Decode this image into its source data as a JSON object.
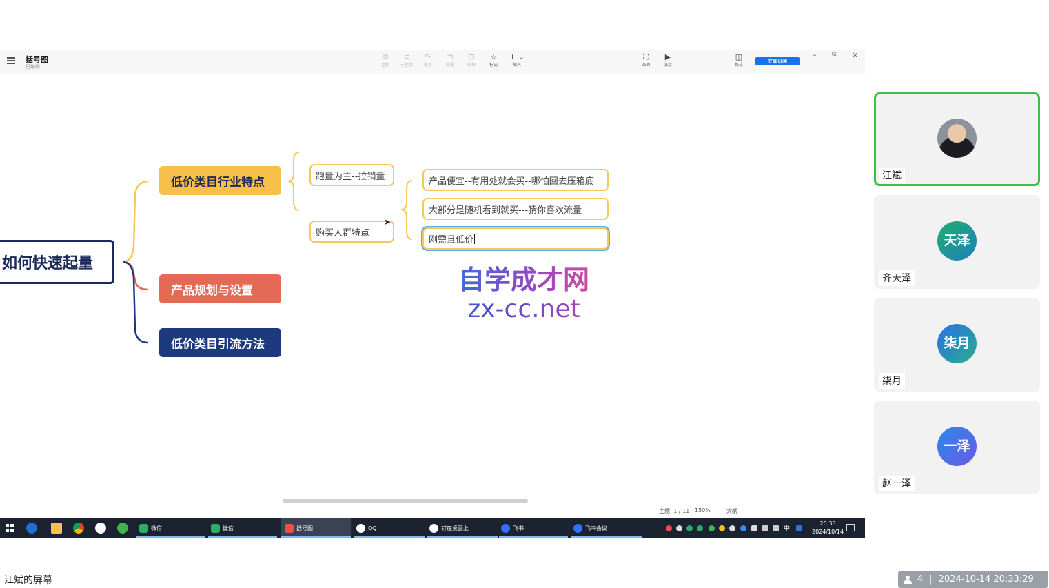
{
  "app": {
    "title": "括号图",
    "subtitle": "已编辑",
    "toolbar": [
      {
        "name": "theme",
        "icon": "⧉",
        "label": "主题",
        "active": false
      },
      {
        "name": "sub-topic",
        "icon": "⊂",
        "label": "子主题",
        "active": false
      },
      {
        "name": "relation",
        "icon": "↷",
        "label": "联系",
        "active": false
      },
      {
        "name": "summary",
        "icon": "⊐",
        "label": "概要",
        "active": false
      },
      {
        "name": "boundary",
        "icon": "⊡",
        "label": "外框",
        "active": false
      },
      {
        "name": "marker",
        "icon": "☆",
        "label": "标记",
        "active": true
      },
      {
        "name": "insert",
        "icon": "+ ⌄",
        "label": "插入",
        "active": true
      }
    ],
    "toolbar_right": [
      {
        "name": "zen",
        "icon": "⛶",
        "label": "ZEN"
      },
      {
        "name": "present",
        "icon": "▶",
        "label": "演示"
      },
      {
        "name": "format",
        "icon": "◫",
        "label": "格式"
      }
    ],
    "subscribe_label": "立即订阅",
    "window_controls": {
      "minimize": "–",
      "restore": "⧉",
      "close": "×"
    }
  },
  "mindmap": {
    "root": "如何快速起量",
    "branches": [
      {
        "label": "低价类目行业特点",
        "color": "#f7c04a"
      },
      {
        "label": "产品规划与设置",
        "color": "#e46a55"
      },
      {
        "label": "低价类目引流方法",
        "color": "#1e3a7e"
      }
    ],
    "sub_topics": [
      "跑量为主--拉销量",
      "购买人群特点"
    ],
    "leaves": [
      "产品便宜--有用处就会买--哪怕回去压箱底",
      "大部分是随机看到就买---猜你喜欢流量",
      "刚需且低价"
    ]
  },
  "watermark": {
    "cn": "自学成才网",
    "en": "zx-cc.net"
  },
  "status_bar": {
    "topic": "主题: 1 / 11",
    "zoom": "150%",
    "outline": "大纲"
  },
  "taskbar": {
    "tasks": [
      {
        "label": "微信",
        "icon_color": "#2aae67",
        "active": false
      },
      {
        "label": "微信",
        "icon_color": "#2aae67",
        "active": false
      },
      {
        "label": "括号图",
        "icon_color": "#e4544a",
        "active": true
      },
      {
        "label": "QQ",
        "icon_color": "#ffffff",
        "active": false
      },
      {
        "label": "钉在桌面上",
        "icon_color": "#ffffff",
        "active": false
      },
      {
        "label": "飞书",
        "icon_color": "#3370ff",
        "active": false
      },
      {
        "label": "飞书会议",
        "icon_color": "#3370ff",
        "active": false
      }
    ],
    "ime": "中",
    "time": "20:33",
    "date": "2024/10/14"
  },
  "participants": [
    {
      "name": "江斌",
      "avatar_text": "",
      "avatar_color": "#8a929c",
      "speaking": true
    },
    {
      "name": "齐天泽",
      "avatar_text": "天泽",
      "avatar_color": "#1f9d8a",
      "speaking": false
    },
    {
      "name": "柒月",
      "avatar_text": "柒月",
      "avatar_color": "#2a8ac8",
      "speaking": false
    },
    {
      "name": "赵一泽",
      "avatar_text": "一泽",
      "avatar_color": "#3a74e8",
      "speaking": false
    }
  ],
  "screen_owner": "江斌的屏幕",
  "meeting": {
    "participant_count": "4",
    "datetime": "2024-10-14 20:33:29"
  }
}
